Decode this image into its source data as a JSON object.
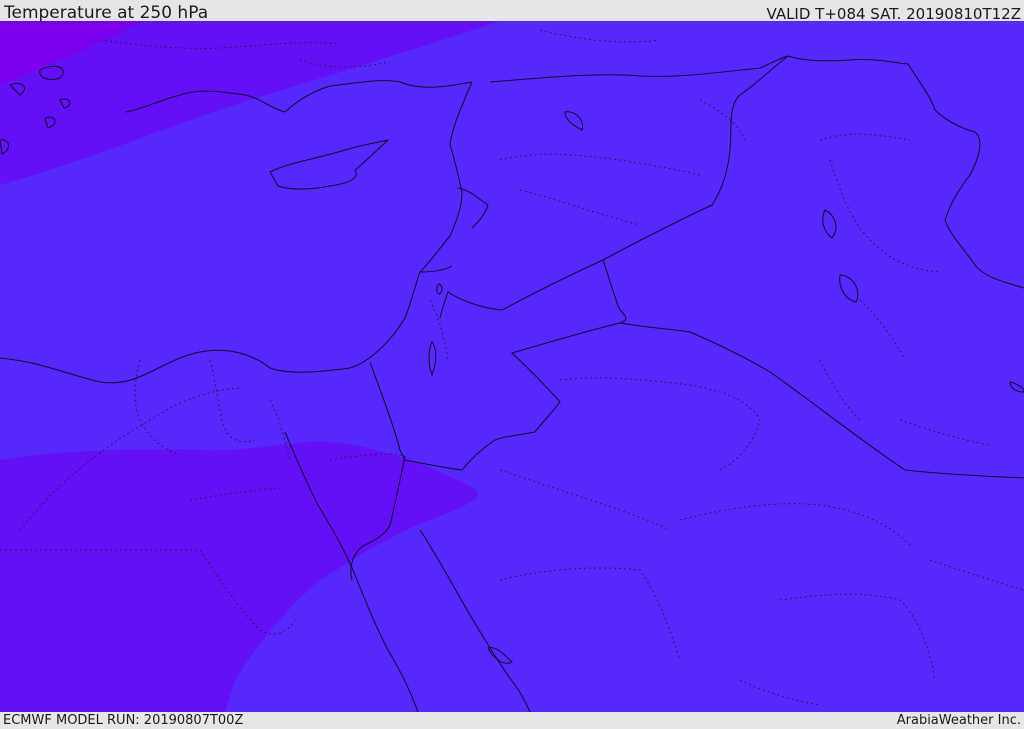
{
  "header": {
    "title": "Temperature at 250 hPa",
    "valid": "VALID T+084 SAT. 20190810T12Z"
  },
  "footer": {
    "model_run": "ECMWF MODEL RUN: 20190807T00Z",
    "credit": "ArabiaWeather Inc."
  },
  "map": {
    "colors": {
      "background_field": "#5628fb",
      "warmer_band": "#6410f6",
      "warmest_patch": "#7a00ee",
      "coastline": "#0b0b2a",
      "border_dotted": "#2a1560"
    },
    "icons": [
      "coastline-layer",
      "political-borders-layer",
      "admin-borders-layer",
      "temperature-shading-layer"
    ]
  }
}
